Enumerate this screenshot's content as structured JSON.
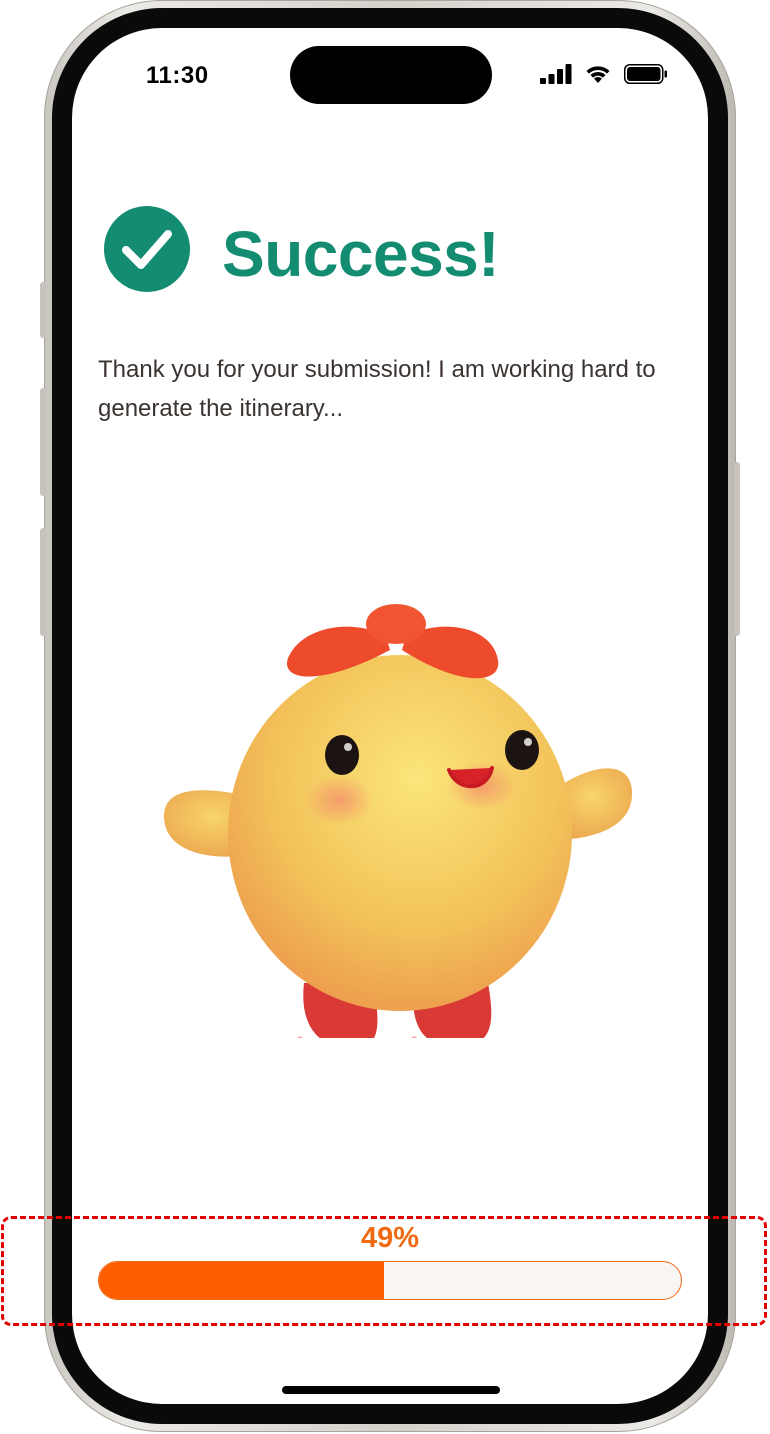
{
  "status_bar": {
    "time": "11:30",
    "icons": [
      "signal-icon",
      "wifi-icon",
      "battery-icon"
    ]
  },
  "header": {
    "icon": "check-circle-icon",
    "title": "Success!"
  },
  "message": "Thank you for your submission! I am working hard to generate the itinerary...",
  "illustration": "mascot-character",
  "progress": {
    "label": "49%",
    "value": 0.49
  },
  "colors": {
    "accent_green": "#138c72",
    "progress_orange": "#ff5e00",
    "highlight_red": "#e10000",
    "text": "#3a3330"
  }
}
